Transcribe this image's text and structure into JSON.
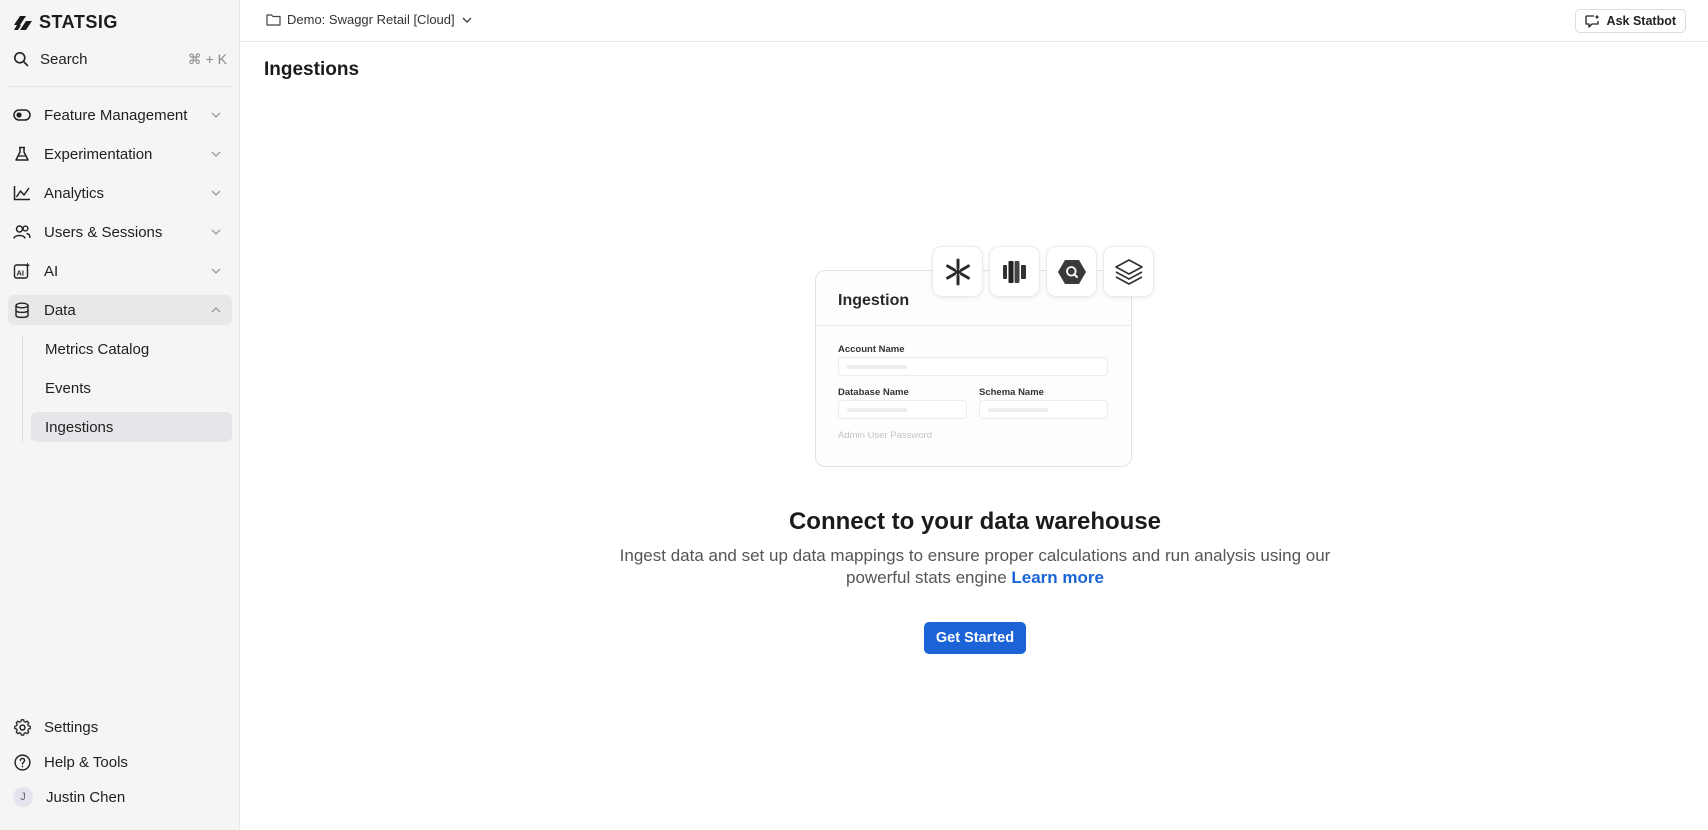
{
  "brand": {
    "name": "STATSIG",
    "accent": "#1b63d6",
    "link": "#1a64d6"
  },
  "search": {
    "label": "Search",
    "shortcut": "⌘ + K",
    "icon": "search-icon"
  },
  "sidebar": {
    "items": [
      {
        "label": "Feature Management",
        "icon": "toggle-icon",
        "expanded": false
      },
      {
        "label": "Experimentation",
        "icon": "flask-icon",
        "expanded": false
      },
      {
        "label": "Analytics",
        "icon": "chart-icon",
        "expanded": false
      },
      {
        "label": "Users & Sessions",
        "icon": "users-icon",
        "expanded": false
      },
      {
        "label": "AI",
        "icon": "ai-icon",
        "expanded": false
      },
      {
        "label": "Data",
        "icon": "database-icon",
        "expanded": true
      }
    ],
    "subitems": [
      {
        "label": "Metrics Catalog"
      },
      {
        "label": "Events"
      },
      {
        "label": "Ingestions",
        "active": true
      }
    ],
    "footer": {
      "settings": "Settings",
      "help": "Help & Tools",
      "user": "Justin Chen",
      "user_initial": "J"
    }
  },
  "topbar": {
    "project": "Demo: Swaggr Retail [Cloud]",
    "statbot": "Ask Statbot"
  },
  "page": {
    "title": "Ingestions"
  },
  "illustration": {
    "card_title": "Ingestion",
    "fields": {
      "account": "Account Name",
      "database": "Database Name",
      "schema": "Schema Name",
      "password": "Admin User Password"
    },
    "logos": [
      "snowflake-icon",
      "redshift-icon",
      "bigquery-icon",
      "databricks-icon"
    ]
  },
  "cta": {
    "title": "Connect to your data warehouse",
    "description": "Ingest data and set up data mappings to ensure proper calculations and run analysis using our powerful stats engine",
    "learn_more": "Learn more",
    "button": "Get Started"
  }
}
